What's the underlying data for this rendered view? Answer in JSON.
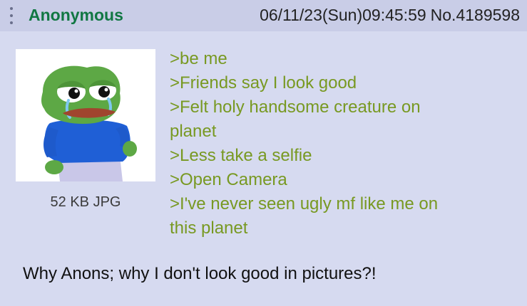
{
  "post": {
    "name": "Anonymous",
    "datetime": "06/11/23(Sun)09:45:59",
    "number": "No.4189598",
    "file_info": "52 KB JPG",
    "thumbnail_icon": "sad-frog-image",
    "greentext": [
      ">be me",
      ">Friends say I look good",
      ">Felt holy handsome creature on",
      "planet",
      ">Less take a selfie",
      ">Open Camera",
      ">I've never seen ugly mf like me on",
      "this planet"
    ],
    "comment": "Why Anons; why I don't look good in pictures?!"
  },
  "colors": {
    "background": "#d6daf0",
    "header": "#c9cde7",
    "name": "#117743",
    "greentext": "#789922"
  }
}
